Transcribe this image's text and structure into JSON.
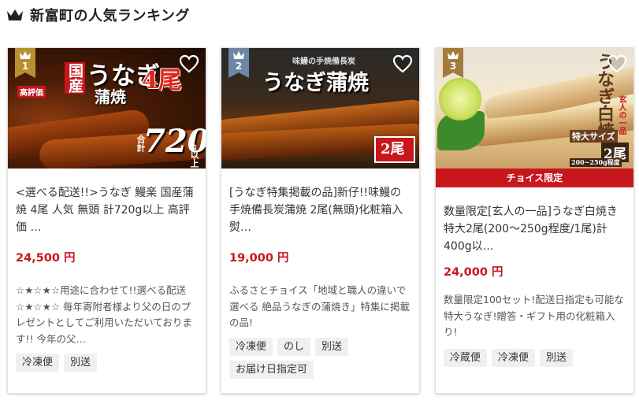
{
  "header": {
    "title": "新富町の人気ランキング",
    "icon": "crown-icon"
  },
  "colors": {
    "price": "#c8161d",
    "banner": "#c8161d",
    "gold": "#b8902f",
    "silver": "#6f87a6",
    "bronze": "#a47a3d"
  },
  "cards": [
    {
      "rank": "1",
      "image_text": {
        "a": "国産",
        "b": "うなぎ",
        "c": "蒲焼",
        "d": "4尾",
        "e": "720",
        "f": "g以上",
        "g": "合計",
        "h": "高評価"
      },
      "title": "<選べる配送!!>うなぎ 鰻楽 国産蒲焼 4尾 人気 無頭 計720g以上 高評価 …",
      "price": "24,500 円",
      "description": "☆★☆★☆用途に合わせて!!選べる配送☆★☆★☆ 毎年寄附者様より父の日のプレゼントとしてご利用いただいております!! 今年の父…",
      "tags": [
        "冷凍便",
        "別送"
      ]
    },
    {
      "rank": "2",
      "image_text": {
        "a": "味鰻の手焼備長炭",
        "b": "うなぎ蒲焼",
        "c": "2尾"
      },
      "title": "[うなぎ特集掲載の品]新仔!!味鰻の手焼備長炭蒲焼 2尾(無頭)化粧箱入 熨…",
      "price": "19,000 円",
      "description": "ふるさとチョイス「地域と職人の違いで選べる 絶品うなぎの蒲焼き」特集に掲載の品!",
      "tags": [
        "冷凍便",
        "のし",
        "別送",
        "お届け日指定可"
      ]
    },
    {
      "rank": "3",
      "banner": "チョイス限定",
      "image_text": {
        "a": "うなぎ白焼",
        "b": "玄人の一品",
        "c": "特大サイズ",
        "d": "2尾",
        "e": "200~250g程度"
      },
      "title": "数量限定[玄人の一品]うなぎ白焼き 特大2尾(200〜250g程度/1尾)計400g以…",
      "price": "24,000 円",
      "description": "数量限定100セット!配送日指定も可能な特大うなぎ!贈答・ギフト用の化粧箱入り!",
      "tags": [
        "冷蔵便",
        "冷凍便",
        "別送"
      ]
    }
  ]
}
